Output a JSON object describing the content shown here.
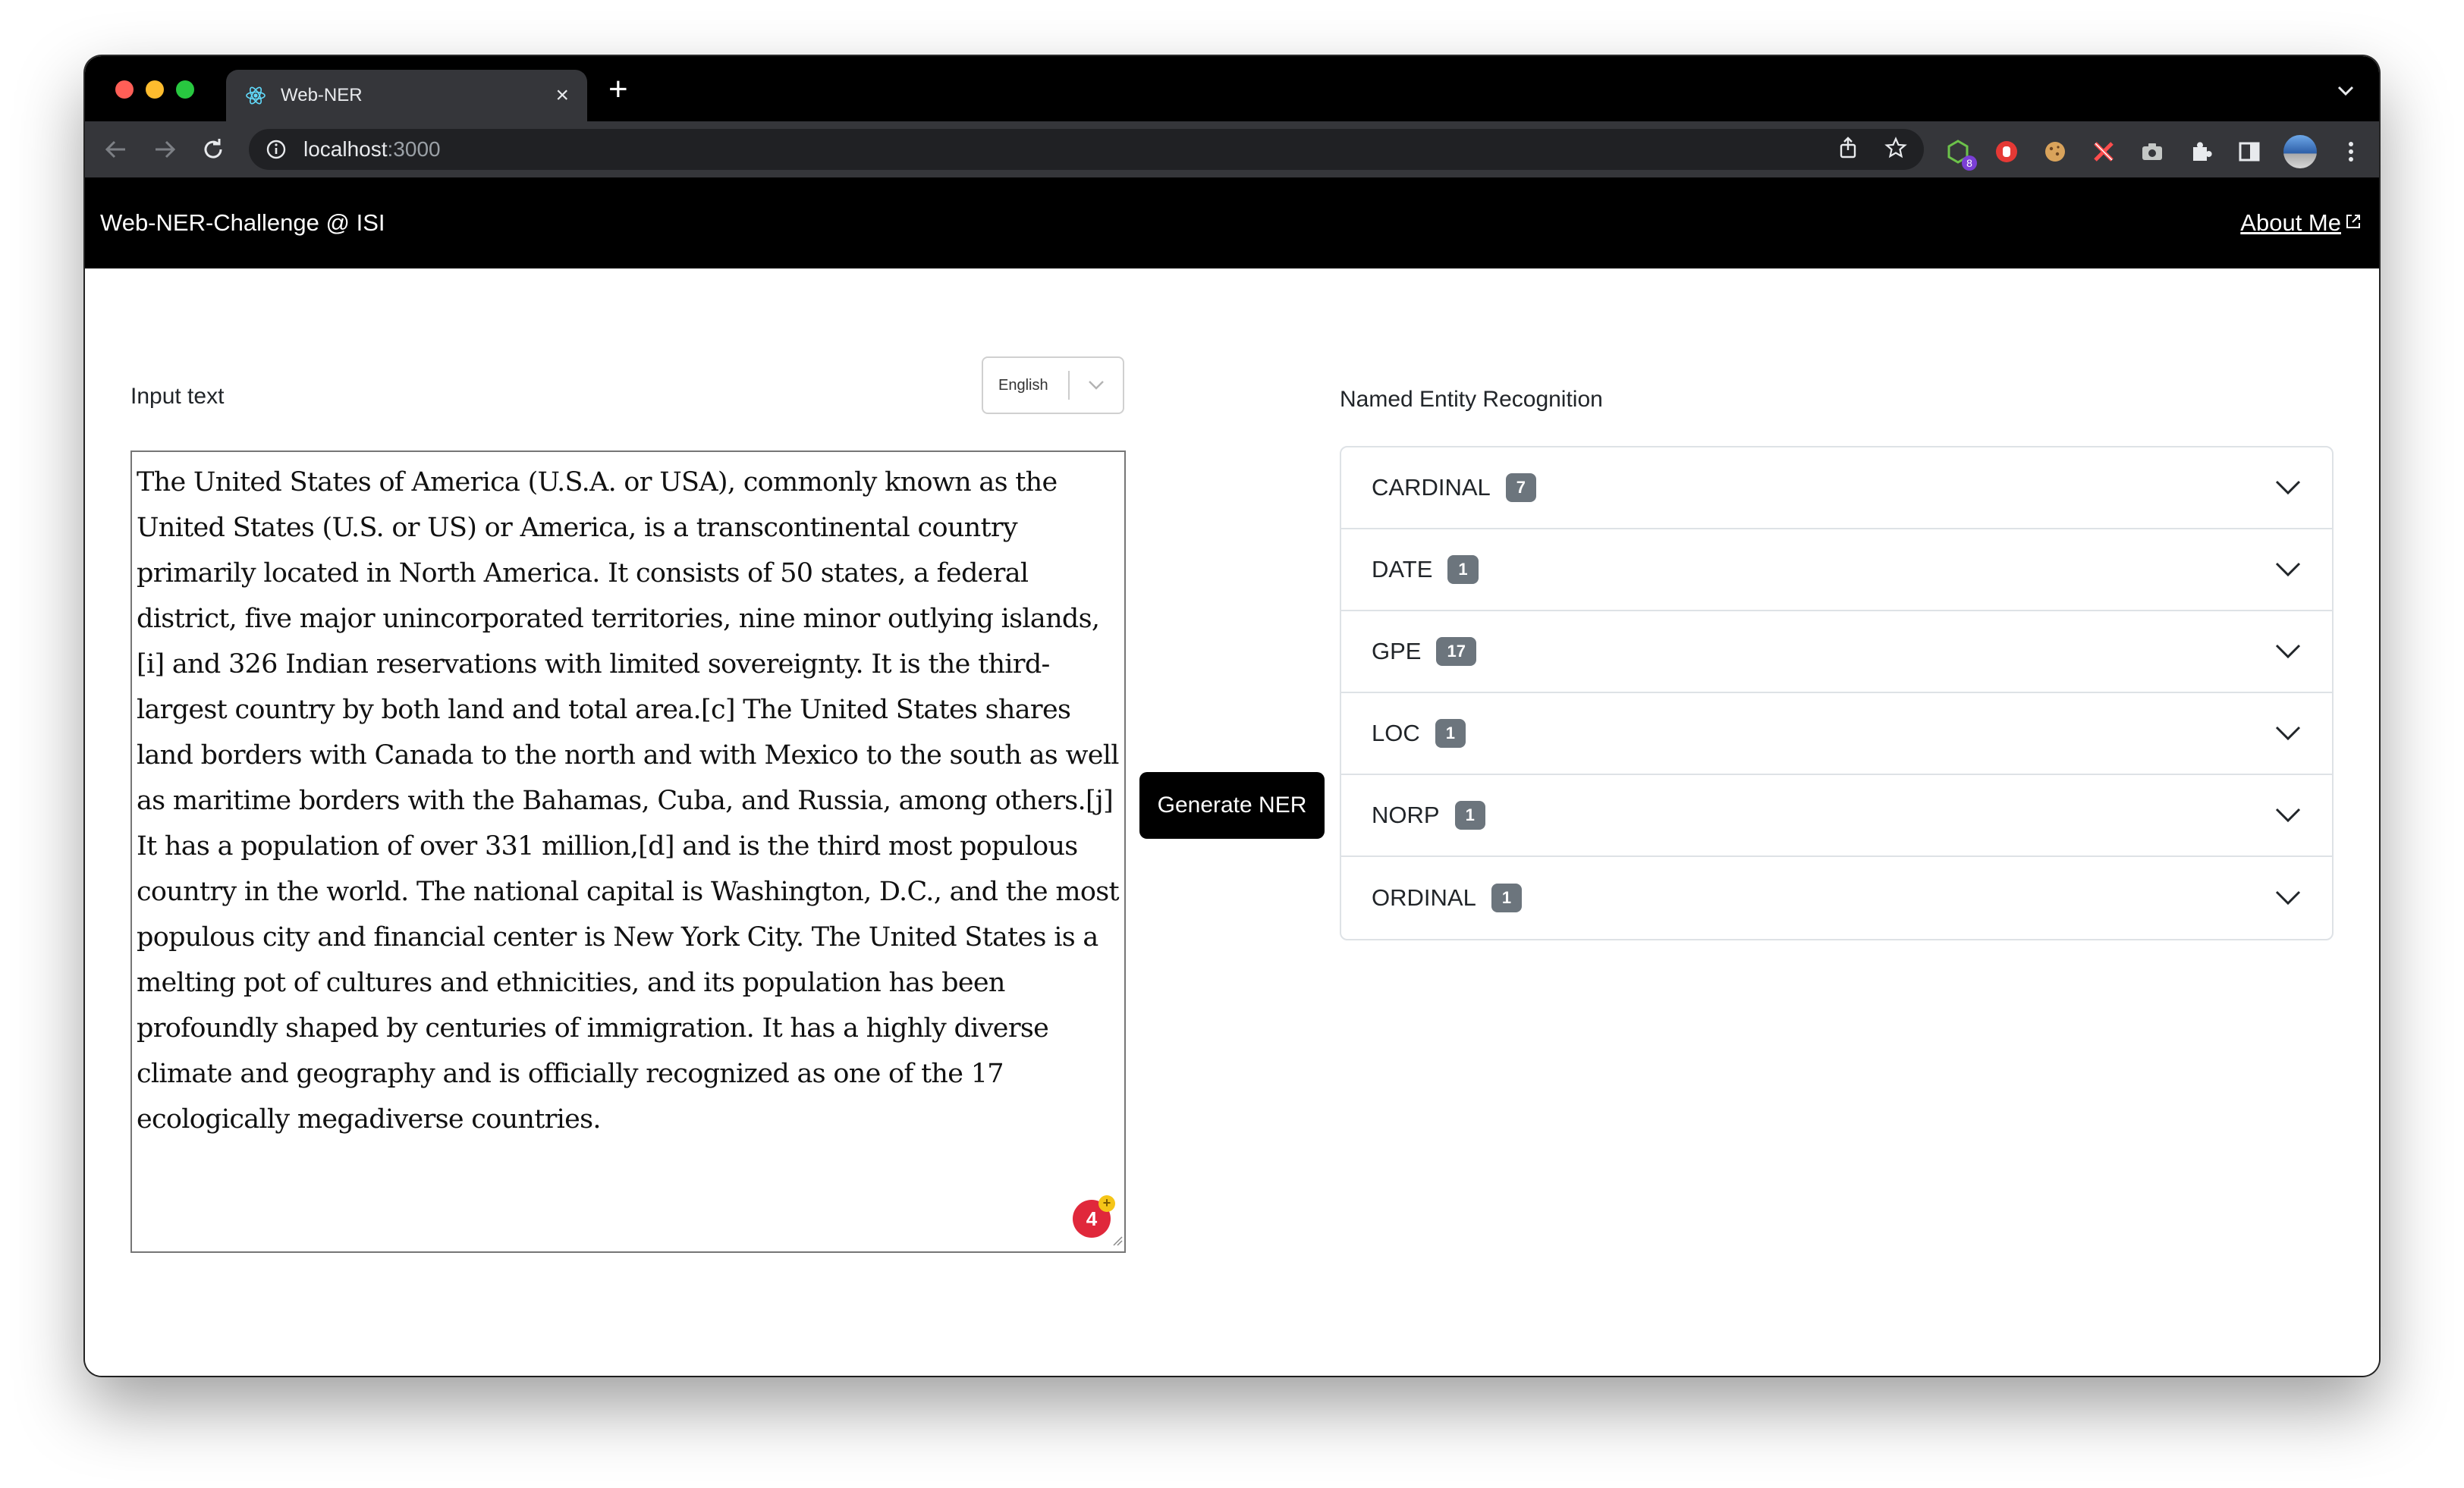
{
  "browser": {
    "tab_title": "Web-NER",
    "url_host": "localhost",
    "url_port": ":3000",
    "extension_badge": "8"
  },
  "navbar": {
    "brand": "Web-NER-Challenge @ ISI",
    "about_link": "About Me"
  },
  "input": {
    "label": "Input text",
    "language": "English",
    "text": "The United States of America (U.S.A. or USA), commonly known as the United States (U.S. or US) or America, is a transcontinental country primarily located in North America. It consists of 50 states, a federal district, five major unincorporated territories, nine minor outlying islands,[i] and 326 Indian reservations with limited sovereignty. It is the third-largest country by both land and total area.[c] The United States shares land borders with Canada to the north and with Mexico to the south as well as maritime borders with the Bahamas, Cuba, and Russia, among others.[j] It has a population of over 331 million,[d] and is the third most populous country in the world. The national capital is Washington, D.C., and the most populous city and financial center is New York City. The United States is a melting pot of cultures and ethnicities, and its population has been profoundly shaped by centuries of immigration. It has a highly diverse climate and geography and is officially recognized as one of the 17 ecologically megadiverse countries.",
    "grammar_count": "4"
  },
  "generate_button": "Generate NER",
  "ner": {
    "title": "Named Entity Recognition",
    "entities": [
      {
        "label": "CARDINAL",
        "count": "7"
      },
      {
        "label": "DATE",
        "count": "1"
      },
      {
        "label": "GPE",
        "count": "17"
      },
      {
        "label": "LOC",
        "count": "1"
      },
      {
        "label": "NORP",
        "count": "1"
      },
      {
        "label": "ORDINAL",
        "count": "1"
      }
    ]
  },
  "colors": {
    "navbar_bg": "#000000",
    "button_bg": "#000000",
    "badge_bg": "#6c757d",
    "grammarly_red": "#e0283b"
  }
}
